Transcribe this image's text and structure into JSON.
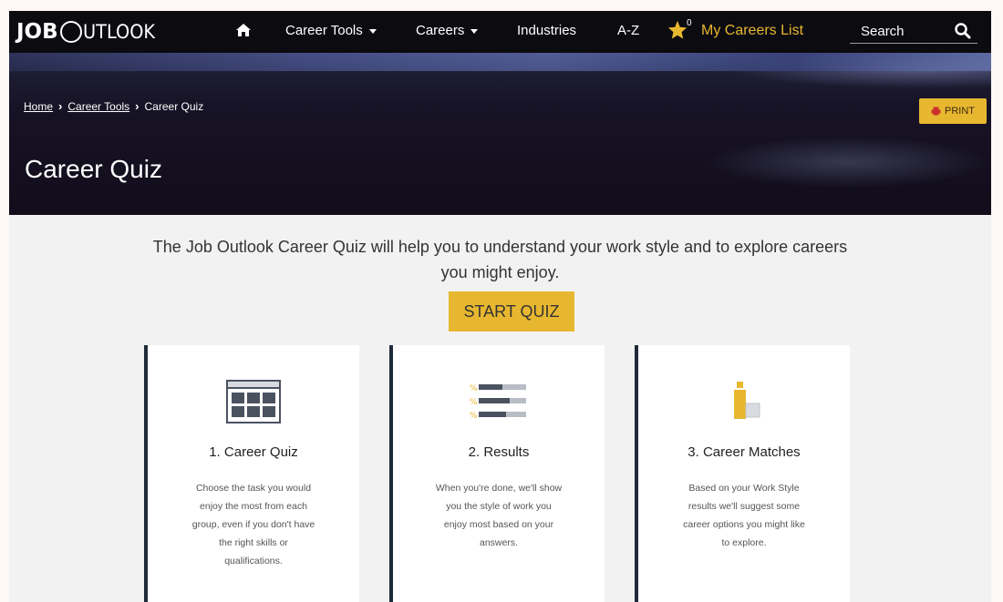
{
  "navbar": {
    "logo": {
      "part1": "JOB",
      "part2": "UTLOOK"
    },
    "home_icon": "home-icon",
    "links": [
      {
        "label": "Career Tools",
        "dropdown": true
      },
      {
        "label": "Careers",
        "dropdown": true
      },
      {
        "label": "Industries",
        "dropdown": false
      },
      {
        "label": "A-Z",
        "dropdown": false
      }
    ],
    "my_careers": {
      "badge": "0",
      "label": "My Careers List",
      "icon": "star-icon"
    },
    "search": {
      "placeholder": "Search",
      "icon": "search-icon"
    }
  },
  "hero": {
    "breadcrumb": [
      {
        "label": "Home",
        "link": true
      },
      {
        "label": "Career Tools",
        "link": true
      },
      {
        "label": "Career Quiz",
        "link": false
      }
    ],
    "title": "Career Quiz",
    "print_label": "PRINT",
    "print_icon": "printer-icon"
  },
  "intro": {
    "line1": "The Job Outlook Career Quiz will help you to understand your work style and to explore careers",
    "line2": "you might enjoy.",
    "start_label": "START QUIZ"
  },
  "cards": [
    {
      "title": "1. Career Quiz",
      "icon": "quiz-grid-icon",
      "lines": [
        "Choose the task you would",
        "enjoy the most from each",
        "group, even if you don't have",
        "the right skills or",
        "qualifications."
      ]
    },
    {
      "title": "2. Results",
      "icon": "results-bars-icon",
      "lines": [
        "When you're done, we'll show",
        "you the style of work you",
        "enjoy most based on your",
        "answers."
      ]
    },
    {
      "title": "3. Career Matches",
      "icon": "career-match-icon",
      "lines": [
        "Based on your Work Style",
        "results we'll suggest some",
        "career options you might like",
        "to explore."
      ]
    }
  ],
  "colors": {
    "navbar_bg": "#0b0b10",
    "accent_gold": "#e8b730",
    "card_border": "#1f2b3a",
    "page_bg": "#f2f2f2"
  }
}
